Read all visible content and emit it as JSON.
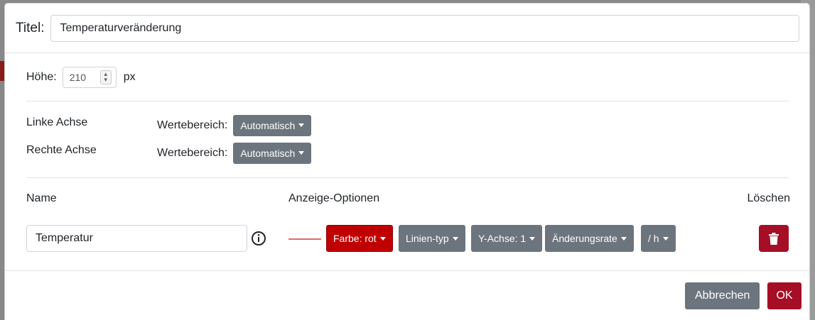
{
  "header": {
    "title_label": "Titel:",
    "title_value": "Temperaturveränderung"
  },
  "height": {
    "label": "Höhe:",
    "value": "210",
    "unit": "px"
  },
  "axes": [
    {
      "name": "Linke Achse",
      "range_label": "Wertebereich:",
      "range_value": "Automatisch"
    },
    {
      "name": "Rechte Achse",
      "range_label": "Wertebereich:",
      "range_value": "Automatisch"
    }
  ],
  "lines": {
    "headers": {
      "name": "Name",
      "options": "Anzeige-Optionen",
      "delete": "Löschen"
    },
    "rows": [
      {
        "name": "Temperatur",
        "color_hex": "#e06c6c",
        "options": {
          "color": "Farbe: rot",
          "line_type": "Linien-typ",
          "y_axis": "Y-Achse: 1",
          "rate": "Änderungsrate",
          "per": "/ h"
        }
      }
    ]
  },
  "footer": {
    "cancel": "Abbrechen",
    "ok": "OK"
  },
  "colors": {
    "primary_red": "#a50e25",
    "secondary": "#6c757d",
    "option_red": "#c00000"
  }
}
